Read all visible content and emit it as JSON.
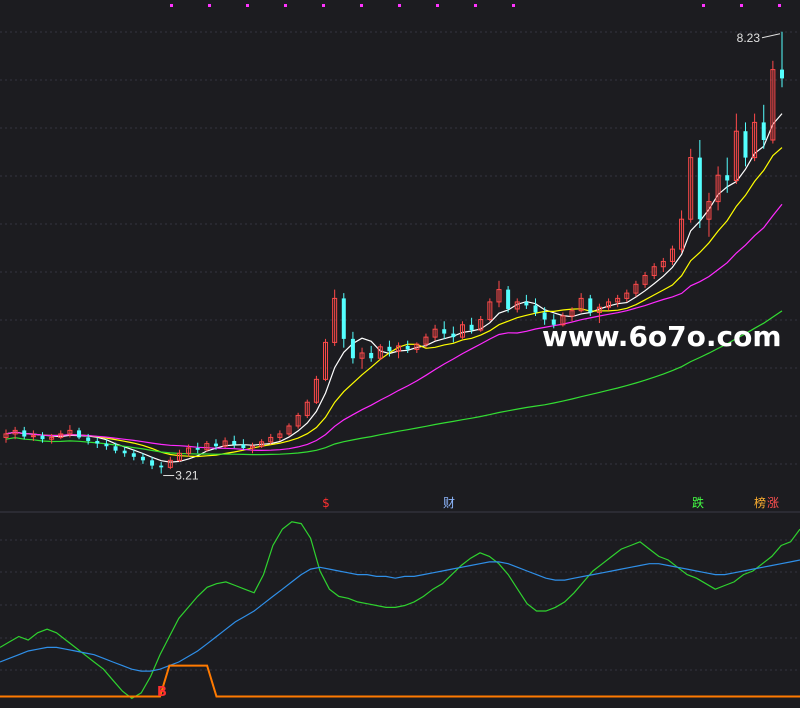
{
  "chart_data": [
    {
      "type": "candlestick",
      "title": "",
      "annotations": {
        "high_label": "8.23",
        "low_label": "3.21",
        "markers": [
          {
            "text": "$",
            "color": "#ff3030"
          },
          {
            "text": "财",
            "color": "#8fb8ff"
          },
          {
            "text": "跌",
            "color": "#44ff44"
          },
          {
            "text": "榜",
            "color": "#ffb030"
          },
          {
            "text": "涨",
            "color": "#ff5050"
          }
        ]
      },
      "ylim": [
        3.0,
        8.5
      ],
      "grid": true,
      "colors": {
        "up": "#ff4a4a",
        "down": "#54ffff",
        "ma_short": "#ffffff",
        "ma_mid": "#ffff00",
        "ma_long": "#ff2aff",
        "ma_longest": "#33dd33",
        "top_dots": "#ff33ff"
      },
      "ohlc": [
        [
          3.62,
          3.71,
          3.56,
          3.66
        ],
        [
          3.66,
          3.74,
          3.6,
          3.7
        ],
        [
          3.7,
          3.74,
          3.6,
          3.63
        ],
        [
          3.63,
          3.7,
          3.58,
          3.64
        ],
        [
          3.64,
          3.68,
          3.56,
          3.6
        ],
        [
          3.6,
          3.66,
          3.55,
          3.62
        ],
        [
          3.62,
          3.7,
          3.6,
          3.66
        ],
        [
          3.66,
          3.76,
          3.62,
          3.7
        ],
        [
          3.7,
          3.73,
          3.6,
          3.62
        ],
        [
          3.62,
          3.66,
          3.54,
          3.58
        ],
        [
          3.58,
          3.62,
          3.5,
          3.55
        ],
        [
          3.55,
          3.6,
          3.48,
          3.52
        ],
        [
          3.52,
          3.56,
          3.44,
          3.47
        ],
        [
          3.47,
          3.51,
          3.4,
          3.44
        ],
        [
          3.44,
          3.48,
          3.36,
          3.4
        ],
        [
          3.4,
          3.44,
          3.32,
          3.36
        ],
        [
          3.36,
          3.4,
          3.26,
          3.3
        ],
        [
          3.3,
          3.34,
          3.21,
          3.28
        ],
        [
          3.28,
          3.4,
          3.26,
          3.36
        ],
        [
          3.36,
          3.48,
          3.34,
          3.44
        ],
        [
          3.44,
          3.54,
          3.4,
          3.5
        ],
        [
          3.5,
          3.56,
          3.44,
          3.48
        ],
        [
          3.48,
          3.58,
          3.46,
          3.55
        ],
        [
          3.55,
          3.6,
          3.48,
          3.52
        ],
        [
          3.52,
          3.62,
          3.5,
          3.58
        ],
        [
          3.58,
          3.64,
          3.5,
          3.54
        ],
        [
          3.54,
          3.6,
          3.48,
          3.5
        ],
        [
          3.5,
          3.56,
          3.44,
          3.52
        ],
        [
          3.52,
          3.6,
          3.5,
          3.57
        ],
        [
          3.57,
          3.66,
          3.54,
          3.62
        ],
        [
          3.62,
          3.7,
          3.58,
          3.66
        ],
        [
          3.66,
          3.78,
          3.64,
          3.75
        ],
        [
          3.75,
          3.9,
          3.72,
          3.87
        ],
        [
          3.87,
          4.05,
          3.84,
          4.02
        ],
        [
          4.02,
          4.32,
          4.0,
          4.28
        ],
        [
          4.28,
          4.74,
          4.26,
          4.7
        ],
        [
          4.7,
          5.3,
          4.66,
          5.2
        ],
        [
          5.2,
          5.26,
          4.64,
          4.74
        ],
        [
          4.74,
          4.82,
          4.46,
          4.52
        ],
        [
          4.52,
          4.64,
          4.4,
          4.58
        ],
        [
          4.58,
          4.66,
          4.48,
          4.52
        ],
        [
          4.52,
          4.68,
          4.5,
          4.65
        ],
        [
          4.65,
          4.72,
          4.54,
          4.6
        ],
        [
          4.6,
          4.7,
          4.52,
          4.66
        ],
        [
          4.66,
          4.72,
          4.58,
          4.62
        ],
        [
          4.62,
          4.7,
          4.58,
          4.68
        ],
        [
          4.68,
          4.8,
          4.64,
          4.76
        ],
        [
          4.76,
          4.9,
          4.72,
          4.85
        ],
        [
          4.85,
          4.94,
          4.74,
          4.8
        ],
        [
          4.8,
          4.88,
          4.7,
          4.76
        ],
        [
          4.76,
          4.94,
          4.74,
          4.9
        ],
        [
          4.9,
          4.98,
          4.8,
          4.84
        ],
        [
          4.84,
          5.0,
          4.82,
          4.96
        ],
        [
          4.96,
          5.2,
          4.94,
          5.16
        ],
        [
          5.16,
          5.4,
          5.1,
          5.3
        ],
        [
          5.3,
          5.34,
          5.04,
          5.08
        ],
        [
          5.08,
          5.2,
          5.04,
          5.16
        ],
        [
          5.16,
          5.24,
          5.08,
          5.12
        ],
        [
          5.12,
          5.2,
          5.0,
          5.04
        ],
        [
          5.04,
          5.1,
          4.9,
          4.96
        ],
        [
          4.96,
          5.02,
          4.86,
          4.9
        ],
        [
          4.9,
          5.04,
          4.88,
          5.0
        ],
        [
          5.0,
          5.1,
          4.94,
          5.06
        ],
        [
          5.06,
          5.26,
          5.04,
          5.2
        ],
        [
          5.2,
          5.24,
          5.0,
          5.04
        ],
        [
          5.04,
          5.14,
          4.92,
          5.1
        ],
        [
          5.1,
          5.2,
          5.06,
          5.16
        ],
        [
          5.16,
          5.24,
          5.1,
          5.2
        ],
        [
          5.2,
          5.3,
          5.16,
          5.26
        ],
        [
          5.26,
          5.4,
          5.22,
          5.36
        ],
        [
          5.36,
          5.5,
          5.32,
          5.46
        ],
        [
          5.46,
          5.6,
          5.42,
          5.56
        ],
        [
          5.56,
          5.66,
          5.5,
          5.62
        ],
        [
          5.62,
          5.8,
          5.58,
          5.76
        ],
        [
          5.76,
          6.2,
          5.72,
          6.1
        ],
        [
          6.1,
          6.9,
          6.06,
          6.8
        ],
        [
          6.8,
          7.0,
          6.0,
          6.1
        ],
        [
          6.1,
          6.4,
          5.9,
          6.3
        ],
        [
          6.3,
          6.7,
          6.2,
          6.6
        ],
        [
          6.6,
          6.8,
          6.4,
          6.54
        ],
        [
          6.54,
          7.3,
          6.5,
          7.1
        ],
        [
          7.1,
          7.2,
          6.7,
          6.8
        ],
        [
          6.8,
          7.3,
          6.76,
          7.2
        ],
        [
          7.2,
          7.4,
          6.9,
          7.0
        ],
        [
          7.0,
          7.9,
          6.96,
          7.8
        ],
        [
          7.8,
          8.23,
          7.6,
          7.7
        ]
      ],
      "ma": [
        {
          "period": 5,
          "color": "#ffffff"
        },
        {
          "period": 10,
          "color": "#ffff00"
        },
        {
          "period": 20,
          "color": "#ff2aff"
        },
        {
          "period": 60,
          "color": "#33dd33"
        }
      ]
    },
    {
      "type": "line",
      "title": "",
      "ylim": [
        0,
        100
      ],
      "series": [
        {
          "color": "#2fd22f",
          "values": [
            30,
            33,
            36,
            34,
            38,
            40,
            38,
            34,
            30,
            26,
            22,
            18,
            12,
            6,
            2,
            5,
            14,
            26,
            36,
            46,
            52,
            58,
            63,
            65,
            66,
            64,
            62,
            60,
            70,
            86,
            95,
            99,
            98,
            90,
            72,
            62,
            58,
            57,
            55,
            54,
            53,
            52,
            52,
            53,
            55,
            58,
            62,
            65,
            70,
            75,
            79,
            82,
            80,
            76,
            70,
            62,
            54,
            50,
            50,
            52,
            55,
            60,
            66,
            72,
            76,
            80,
            84,
            86,
            88,
            84,
            80,
            78,
            74,
            70,
            68,
            65,
            62,
            64,
            66,
            70,
            72,
            76,
            80,
            86,
            88,
            95
          ]
        },
        {
          "color": "#2f8fe8",
          "values": [
            22,
            24,
            26,
            28,
            29,
            30,
            30,
            29,
            28,
            27,
            26,
            24,
            22,
            20,
            18,
            17,
            17,
            18,
            20,
            22,
            25,
            28,
            32,
            36,
            40,
            44,
            47,
            50,
            54,
            58,
            62,
            66,
            70,
            73,
            74,
            73,
            72,
            71,
            70,
            70,
            69,
            69,
            68,
            69,
            69,
            70,
            71,
            72,
            73,
            74,
            75,
            76,
            77,
            77,
            76,
            74,
            72,
            70,
            68,
            67,
            67,
            68,
            69,
            70,
            71,
            72,
            73,
            74,
            75,
            76,
            76,
            75,
            74,
            73,
            72,
            71,
            70,
            70,
            71,
            72,
            73,
            74,
            75,
            76,
            77,
            78
          ]
        },
        {
          "color": "#ff7a00",
          "values": [
            3,
            3,
            3,
            3,
            3,
            3,
            3,
            3,
            3,
            3,
            3,
            3,
            3,
            3,
            3,
            3,
            3,
            3,
            20,
            20,
            20,
            20,
            20,
            3,
            3,
            3,
            3,
            3,
            3,
            3,
            3,
            3,
            3,
            3,
            3,
            3,
            3,
            3,
            3,
            3,
            3,
            3,
            3,
            3,
            3,
            3,
            3,
            3,
            3,
            3,
            3,
            3,
            3,
            3,
            3,
            3,
            3,
            3,
            3,
            3,
            3,
            3,
            3,
            3,
            3,
            3,
            3,
            3,
            3,
            3,
            3,
            3,
            3,
            3,
            3,
            3,
            3,
            3,
            3,
            3,
            3,
            3,
            3,
            3,
            3,
            3
          ]
        }
      ],
      "annotations": [
        {
          "text": "B",
          "color": "#ff3030"
        }
      ]
    }
  ],
  "watermark": {
    "text": "www.6o7o.com"
  }
}
